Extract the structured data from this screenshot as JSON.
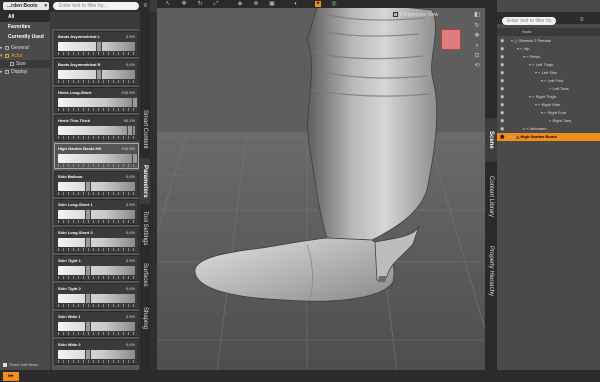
{
  "left": {
    "preset_dropdown": "...rden Boots",
    "filter_placeholder": "Enter text to filter by...",
    "categories": [
      "All",
      "Favorites",
      "Currently Used"
    ],
    "tree": [
      {
        "label": "General",
        "expanded": false,
        "active": false
      },
      {
        "label": "Actor",
        "expanded": true,
        "active": true
      },
      {
        "label": "Size",
        "expanded": false,
        "active": false
      },
      {
        "label": "Display",
        "expanded": false,
        "active": false
      }
    ],
    "show_sub_items": "Show Sub Items",
    "sliders": [
      {
        "label": "Boots Asymmetrical L",
        "value": "0.0%"
      },
      {
        "label": "Boots Asymmetrical R",
        "value": "0.0%"
      },
      {
        "label": "Heels Long-Short",
        "value": "100.0%"
      },
      {
        "label": "Heels Thin-Thick",
        "value": "90.2%"
      },
      {
        "label": "High Garden Boots HD",
        "value": "100.0%"
      },
      {
        "label": "Shin Balloon",
        "value": "0.0%"
      },
      {
        "label": "Shin Long-Short 1",
        "value": "0.0%"
      },
      {
        "label": "Shin Long-Short 2",
        "value": "0.0%"
      },
      {
        "label": "Shin Tight 1",
        "value": "0.0%"
      },
      {
        "label": "Shin Tight 2",
        "value": "0.0%"
      },
      {
        "label": "Shin Wide 1",
        "value": "0.0%"
      },
      {
        "label": "Shin Wide 2",
        "value": "0.0%"
      }
    ],
    "tabs": [
      "Smart Content",
      "Parameters",
      "Tool Settings",
      "Surfaces",
      "Shaping"
    ],
    "active_tab": "Parameters"
  },
  "viewport": {
    "camera_label": "Perspective View"
  },
  "right": {
    "filter_placeholder": "Enter text to filter by...",
    "column_header": "Node",
    "tabs": [
      "Scene",
      "Content Library",
      "Property Hierarchy"
    ],
    "rows": [
      {
        "label": "Genesis 2 Female",
        "indent": 0,
        "selected": false
      },
      {
        "label": "Hip",
        "indent": 1,
        "selected": false
      },
      {
        "label": "Pelvis",
        "indent": 2,
        "selected": false
      },
      {
        "label": "Left Thigh",
        "indent": 3,
        "selected": false
      },
      {
        "label": "Left Shin",
        "indent": 4,
        "selected": false
      },
      {
        "label": "Left Foot",
        "indent": 5,
        "selected": false
      },
      {
        "label": "Left Toes",
        "indent": 6,
        "selected": false
      },
      {
        "label": "Right Thigh",
        "indent": 3,
        "selected": false
      },
      {
        "label": "Right Shin",
        "indent": 4,
        "selected": false
      },
      {
        "label": "Right Foot",
        "indent": 5,
        "selected": false
      },
      {
        "label": "Right Toes",
        "indent": 6,
        "selected": false
      },
      {
        "label": "Abdomen",
        "indent": 2,
        "selected": false
      },
      {
        "label": "High Garden Boots",
        "indent": 0,
        "selected": true
      }
    ]
  },
  "colors": {
    "accent": "#f28c1c",
    "panel": "#4a4a4a",
    "dark": "#2c2c2c"
  }
}
